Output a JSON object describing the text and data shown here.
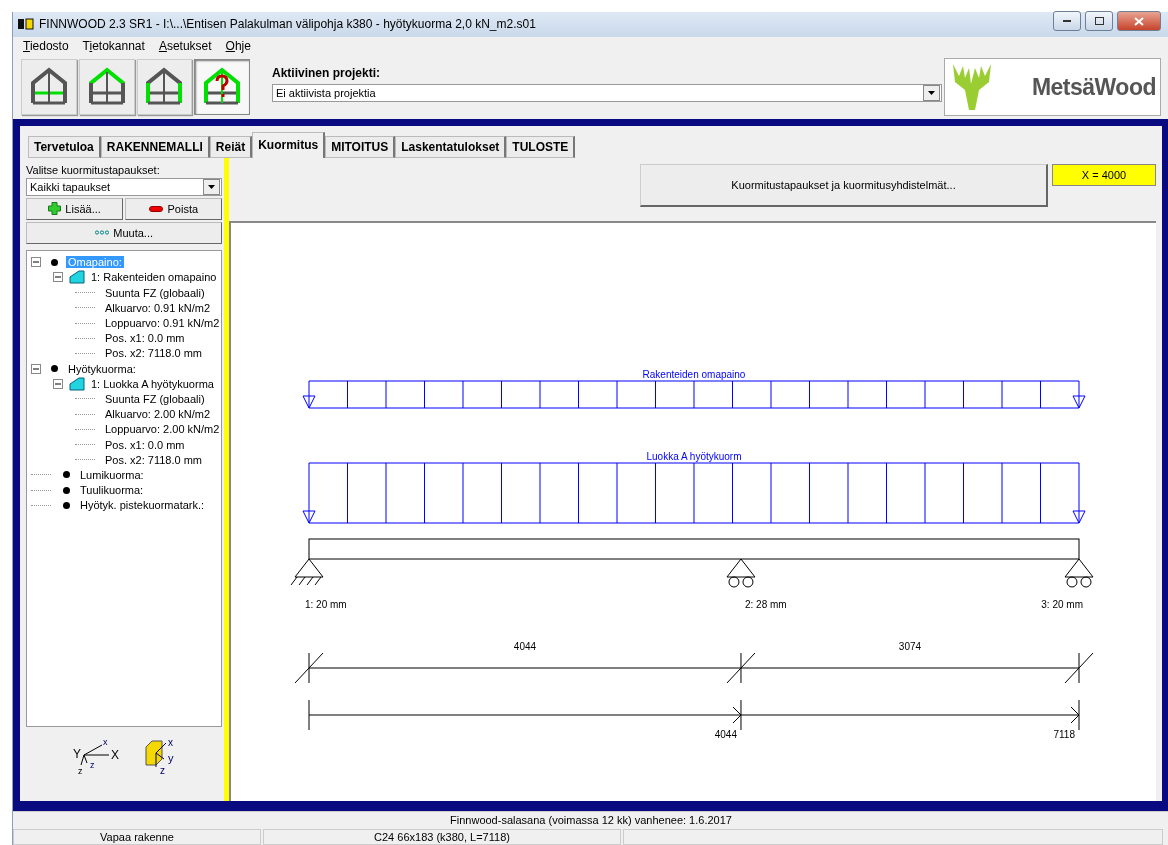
{
  "window": {
    "title": "FINNWOOD 2.3 SR1 - I:\\...\\Entisen Palakulman välipohja k380 - hyötykuorma 2,0 kN_m2.s01"
  },
  "menu": [
    "Tiedosto",
    "Tietokannat",
    "Asetukset",
    "Ohje"
  ],
  "toolbar": [
    {
      "kind": "floor",
      "selected": false
    },
    {
      "kind": "roof",
      "selected": false
    },
    {
      "kind": "wall",
      "selected": false
    },
    {
      "kind": "help",
      "selected": true
    }
  ],
  "project": {
    "label": "Aktiivinen projekti:",
    "value": "Ei aktiivista projektia"
  },
  "logo": {
    "text": "MetsäWood"
  },
  "tabs": [
    {
      "label": "Tervetuloa",
      "selected": false
    },
    {
      "label": "RAKENNEMALLI",
      "selected": false
    },
    {
      "label": "Reiät",
      "selected": false
    },
    {
      "label": "Kuormitus",
      "selected": true
    },
    {
      "label": "MITOITUS",
      "selected": false
    },
    {
      "label": "Laskentatulokset",
      "selected": false
    },
    {
      "label": "TULOSTE",
      "selected": false
    }
  ],
  "sidebar": {
    "select_label": "Valitse kuormitustapaukset:",
    "select_value": "Kaikki tapaukset",
    "buttons": [
      {
        "kind": "add",
        "label": "Lisää..."
      },
      {
        "kind": "remove",
        "label": "Poista"
      },
      {
        "kind": "edit",
        "label": "Muuta..."
      }
    ],
    "tree": [
      {
        "label": "Omapaino:",
        "kind": "group",
        "selected": true,
        "expanded": true,
        "children": [
          {
            "label": "1: Rakenteiden omapaino",
            "kind": "load",
            "selected": false,
            "expanded": true,
            "children": [
              {
                "label": "Suunta FZ (globaali)",
                "kind": "property",
                "selected": false
              },
              {
                "label": "Alkuarvo: 0.91 kN/m2",
                "kind": "property",
                "selected": false
              },
              {
                "label": "Loppuarvo: 0.91 kN/m2",
                "kind": "property",
                "selected": false
              },
              {
                "label": "Pos. x1: 0.0 mm",
                "kind": "property",
                "selected": false
              },
              {
                "label": "Pos. x2: 7118.0 mm",
                "kind": "property",
                "selected": false
              }
            ]
          }
        ]
      },
      {
        "label": "Hyötykuorma:",
        "kind": "group",
        "selected": false,
        "expanded": true,
        "children": [
          {
            "label": "1:  Luokka A hyötykuorma",
            "kind": "load",
            "selected": false,
            "expanded": true,
            "children": [
              {
                "label": "Suunta FZ (globaali)",
                "kind": "property",
                "selected": false
              },
              {
                "label": "Alkuarvo: 2.00 kN/m2",
                "kind": "property",
                "selected": false
              },
              {
                "label": "Loppuarvo: 2.00 kN/m2",
                "kind": "property",
                "selected": false
              },
              {
                "label": "Pos. x1: 0.0 mm",
                "kind": "property",
                "selected": false
              },
              {
                "label": "Pos. x2: 7118.0 mm",
                "kind": "property",
                "selected": false
              }
            ]
          }
        ]
      },
      {
        "label": "Lumikuorma:",
        "kind": "group",
        "selected": false
      },
      {
        "label": "Tuulikuorma:",
        "kind": "group",
        "selected": false
      },
      {
        "label": "Hyötyk. pistekuormatark.:",
        "kind": "group",
        "selected": false
      }
    ]
  },
  "load_cases_button": "Kuormitustapaukset ja kuormitusyhdistelmät...",
  "coordinate": "X = 4000",
  "axes": {
    "global": [
      "x",
      "Y",
      "X",
      "z",
      "z"
    ],
    "local": [
      "x",
      "y",
      "z"
    ]
  },
  "diagram": {
    "loads": [
      {
        "label": "Rakenteiden omapaino",
        "kind": "light"
      },
      {
        "label": "Luokka A hyötykuorm",
        "kind": "heavy"
      }
    ],
    "supports": [
      {
        "kind": "pinned",
        "label": "1: 20 mm"
      },
      {
        "kind": "roller",
        "label": "2: 28 mm"
      },
      {
        "kind": "roller",
        "label": "3: 20 mm"
      }
    ],
    "spans": [
      "4044",
      "3074"
    ],
    "cumulative": [
      "4044",
      "7118"
    ]
  },
  "status_bar": {
    "message": "Finnwood-salasana (voimassa 12 kk) vanhenee: 1.6.2017",
    "panels": [
      "Vapaa rakenne",
      "C24 66x183 (k380, L=7118)"
    ]
  }
}
